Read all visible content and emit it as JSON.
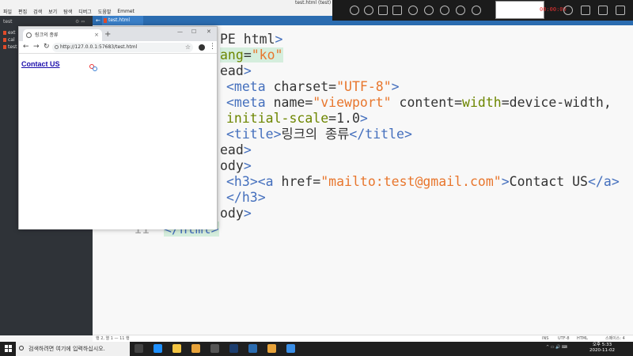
{
  "app": {
    "title": "test.html (test) - Brackets",
    "menu": [
      "파일",
      "편집",
      "검색",
      "보기",
      "탐색",
      "디버그",
      "도움말",
      "Emmet"
    ]
  },
  "sidebar": {
    "project": "test",
    "files": [
      "ext",
      "cal",
      "test"
    ]
  },
  "editor_tab": {
    "filename": "test.html"
  },
  "recorder": {
    "timer": "00:00:00"
  },
  "code_lines": [
    {
      "num": "",
      "html": "PE html&gt;"
    },
    {
      "num": "",
      "html": "ang=\"ko\""
    },
    {
      "num": "",
      "html": "ead&gt;"
    },
    {
      "num": "",
      "html": "<meta charset=\"UTF-8\">"
    },
    {
      "num": "",
      "html": "<meta name=\"viewport\" content=\"width=device-width,"
    },
    {
      "num": "",
      "html": "initial-scale=1.0\">"
    },
    {
      "num": "",
      "html": "<title>링크의 종류</title>"
    },
    {
      "num": "",
      "html": "ead>"
    },
    {
      "num": "",
      "html": "ody>"
    },
    {
      "num": "",
      "html": "<h3><a href=\"mailto:test@gmail.com\">Contact US</a>"
    },
    {
      "num": "",
      "html": "</h3>"
    },
    {
      "num": "",
      "html": "ody>"
    },
    {
      "num": "11",
      "html": "</html>"
    }
  ],
  "statusbar": {
    "position": "행 2, 열 1 — 11 행",
    "ins": "INS",
    "encoding": "UTF-8",
    "language": "HTML",
    "spaces": "스페이스: 4"
  },
  "browser": {
    "tab_title": "링크의 종류",
    "url": "http://127.0.0.1:57683/test.html",
    "page_link_text": "Contact US",
    "page_link_href": "mailto:test@gmail.com"
  },
  "taskbar": {
    "search_placeholder": "검색하려면 여기에 입력하십시오.",
    "time": "오후 5:33",
    "date": "2020-11-02",
    "apps": [
      {
        "name": "task-view",
        "color": "#444"
      },
      {
        "name": "edge",
        "color": "#1e90ff"
      },
      {
        "name": "explorer",
        "color": "#f4c542"
      },
      {
        "name": "chrome",
        "color": "#e8a33a"
      },
      {
        "name": "store",
        "color": "#555"
      },
      {
        "name": "photoshop",
        "color": "#1c3d6e"
      },
      {
        "name": "app-box",
        "color": "#2b6cb0"
      },
      {
        "name": "chrome-2",
        "color": "#e8a33a"
      },
      {
        "name": "brackets",
        "color": "#3a8ee6"
      }
    ]
  }
}
